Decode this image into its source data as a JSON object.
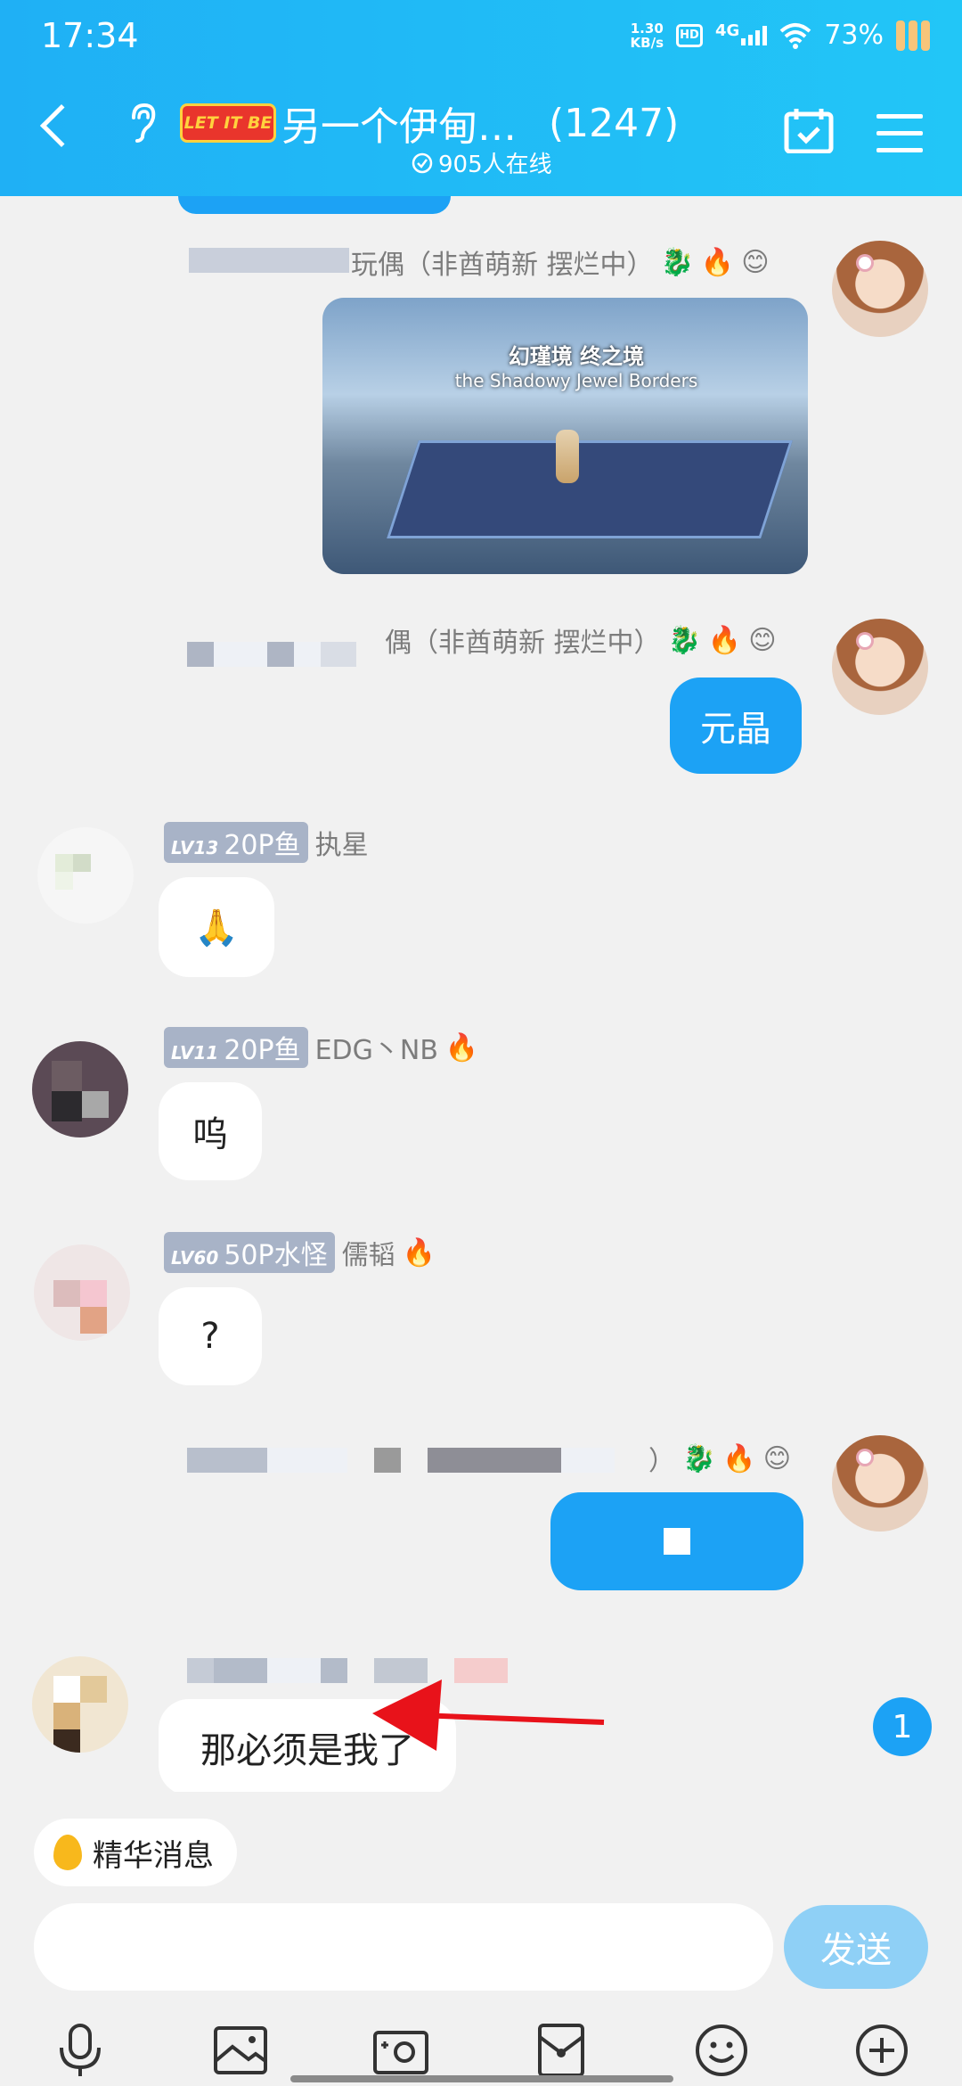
{
  "status_bar": {
    "time": "17:34",
    "net_speed_value": "1.30",
    "net_speed_unit": "KB/s",
    "hd": "HD",
    "network": "4G",
    "battery": "73%"
  },
  "header": {
    "logo_text": "LET IT BE",
    "group_name": "另一个伊甸…",
    "member_count": "(1247)",
    "online": "905人在线"
  },
  "messages": {
    "m1": {
      "name_visible": "玩偶（非酋萌新 摆烂中）"
    },
    "m2": {
      "name_visible": "偶（非酋萌新 摆烂中）",
      "text": "元晶"
    },
    "m3": {
      "level": "LV13",
      "title": "20P鱼",
      "name": "执星",
      "text": "🙏"
    },
    "m4": {
      "level": "LV11",
      "title": "20P鱼",
      "name": "EDG丶NB",
      "text": "呜"
    },
    "m5": {
      "level": "LV60",
      "title": "50P水怪",
      "name": "儒韬",
      "text": "?"
    },
    "m6": {
      "name_visible": "）"
    },
    "m7": {
      "text": "那必须是我了"
    }
  },
  "game_image": {
    "banner_top": "幻瑾境 终之境",
    "banner_sub": "the Shadowy Jewel Borders"
  },
  "unread_count": "1",
  "input": {
    "essence_label": "精华消息",
    "placeholder": "",
    "send_label": "发送"
  },
  "colors": {
    "header": "#1fb0f5",
    "my_bubble": "#1ca2f5",
    "send_disabled": "#8fd0f6",
    "annotation_arrow": "#e8121a"
  },
  "toolbar": {
    "icons": [
      "microphone-icon",
      "image-icon",
      "camera-icon",
      "red-packet-icon",
      "emoji-icon",
      "plus-icon"
    ]
  }
}
